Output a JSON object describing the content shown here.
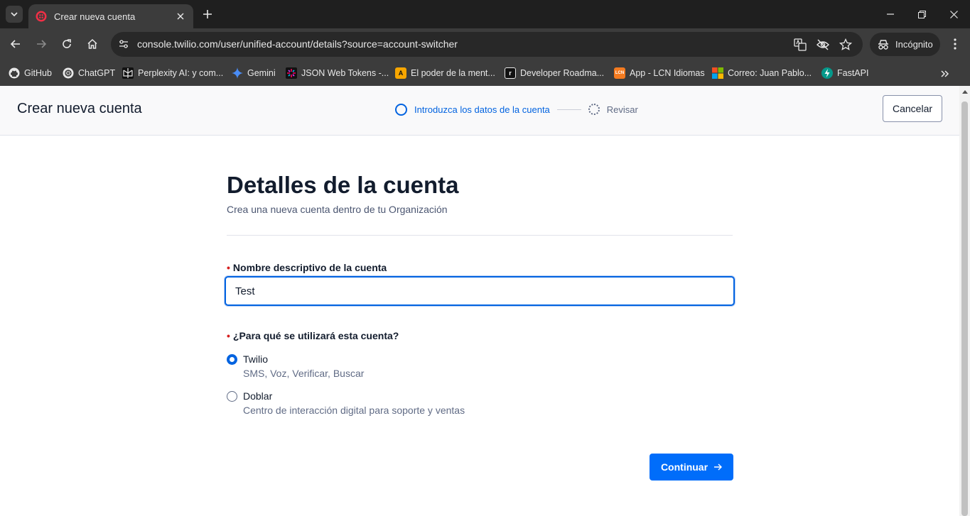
{
  "browser": {
    "tab_title": "Crear nueva cuenta",
    "url": "console.twilio.com/user/unified-account/details?source=account-switcher",
    "incognito_label": "Incógnito",
    "bookmarks": [
      {
        "label": "GitHub",
        "icon": "github-icon"
      },
      {
        "label": "ChatGPT",
        "icon": "chatgpt-icon"
      },
      {
        "label": "Perplexity AI: y com...",
        "icon": "perplexity-icon"
      },
      {
        "label": "Gemini",
        "icon": "gemini-icon"
      },
      {
        "label": "JSON Web Tokens -...",
        "icon": "jwt-icon"
      },
      {
        "label": "El poder de la ment...",
        "icon": "audible-icon"
      },
      {
        "label": "Developer Roadma...",
        "icon": "roadmap-icon"
      },
      {
        "label": "App - LCN Idiomas",
        "icon": "lcn-icon"
      },
      {
        "label": "Correo: Juan Pablo...",
        "icon": "microsoft-icon"
      },
      {
        "label": "FastAPI",
        "icon": "fastapi-icon"
      }
    ]
  },
  "header": {
    "title": "Crear nueva cuenta",
    "steps": [
      {
        "label": "Introduzca los datos de la cuenta",
        "state": "active"
      },
      {
        "label": "Revisar",
        "state": "pending"
      }
    ],
    "cancel_label": "Cancelar"
  },
  "form": {
    "heading": "Detalles de la cuenta",
    "subheading": "Crea una nueva cuenta dentro de tu Organización",
    "name_label": "Nombre descriptivo de la cuenta",
    "name_value": "Test",
    "usage_label": "¿Para qué se utilizará esta cuenta?",
    "options": [
      {
        "title": "Twilio",
        "desc": "SMS, Voz, Verificar, Buscar",
        "selected": true
      },
      {
        "title": "Doblar",
        "desc": "Centro de interacción digital para soporte y ventas",
        "selected": false
      }
    ],
    "continue_label": "Continuar",
    "continue_icon": "arrow-right-icon"
  },
  "colors": {
    "accent": "#0263e0",
    "button": "#006dfa",
    "required": "#d61f1f"
  }
}
